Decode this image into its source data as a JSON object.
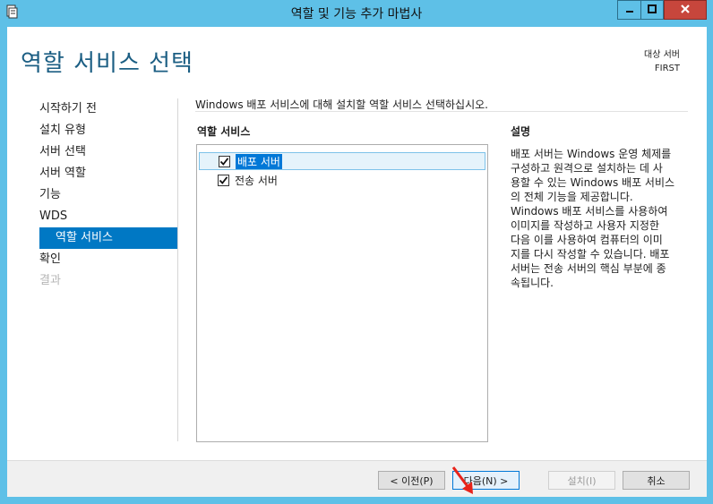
{
  "window": {
    "title": "역할 및 기능 추가 마법사"
  },
  "header": {
    "page_title": "역할 서비스 선택",
    "target_label": "대상 서버",
    "target_server": "FIRST"
  },
  "nav": {
    "items": [
      {
        "label": "시작하기 전",
        "state": "normal"
      },
      {
        "label": "설치 유형",
        "state": "normal"
      },
      {
        "label": "서버 선택",
        "state": "normal"
      },
      {
        "label": "서버 역할",
        "state": "normal"
      },
      {
        "label": "기능",
        "state": "normal"
      },
      {
        "label": "WDS",
        "state": "normal"
      },
      {
        "label": "역할 서비스",
        "state": "active"
      },
      {
        "label": "확인",
        "state": "normal"
      },
      {
        "label": "결과",
        "state": "disabled"
      }
    ]
  },
  "main": {
    "instruction": "Windows 배포 서비스에 대해 설치할 역할 서비스 선택하십시오.",
    "services_header": "역할 서비스",
    "services": [
      {
        "label": "배포 서버",
        "checked": true,
        "selected": true
      },
      {
        "label": "전송 서버",
        "checked": true,
        "selected": false
      }
    ],
    "description_header": "설명",
    "description_lines": [
      "배포 서버는 Windows 운영 체제를",
      "구성하고 원격으로 설치하는 데 사",
      "용할 수 있는 Windows 배포 서비스",
      "의 전체 기능을 제공합니다.",
      "Windows 배포 서비스를 사용하여",
      "이미지를 작성하고 사용자 지정한",
      "다음 이를 사용하여 컴퓨터의 이미",
      "지를 다시 작성할 수 있습니다. 배포",
      "서버는 전송 서버의 핵심 부분에 종",
      "속됩니다."
    ]
  },
  "footer": {
    "prev_label": "< 이전(P)",
    "next_label": "다음(N) >",
    "install_label": "설치(I)",
    "cancel_label": "취소"
  },
  "colors": {
    "accent": "#0078c4",
    "title_blue": "#1b5e83",
    "chrome": "#5ec0e7",
    "close_red": "#c7463c",
    "annotation_arrow": "#e8231a"
  }
}
